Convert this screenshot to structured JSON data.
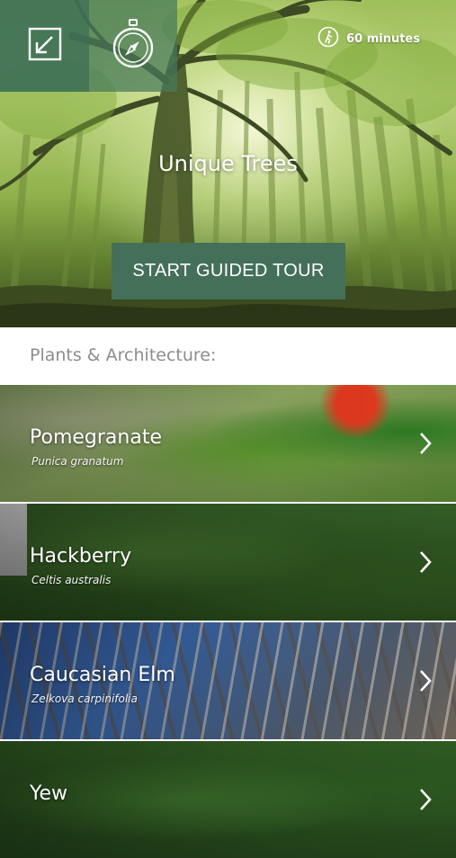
{
  "hero": {
    "title": "Unique Trees",
    "duration": "60 minutes",
    "tour_button_label": "START GUIDED TOUR"
  },
  "section": {
    "title": "Plants & Architecture:"
  },
  "items": [
    {
      "name": "Pomegranate",
      "latin": "Punica granatum"
    },
    {
      "name": "Hackberry",
      "latin": "Celtis australis"
    },
    {
      "name": "Caucasian Elm",
      "latin": "Zelkova carpinifolia"
    },
    {
      "name": "Yew",
      "latin": ""
    }
  ],
  "icons": {
    "top_left": "expand-icon",
    "top_second": "compass-icon",
    "duration": "walking-person-icon",
    "list": "chevron-right-icon"
  },
  "colors": {
    "brand_green": "#44705a",
    "section_text": "#8c8c8c"
  }
}
